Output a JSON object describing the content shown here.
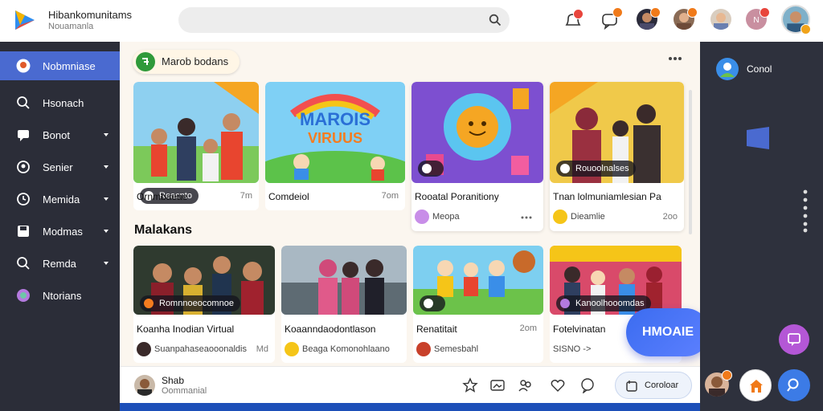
{
  "header": {
    "brand_title": "Hibankomunitams",
    "brand_subtitle": "Nouamanla",
    "search_placeholder": "",
    "icons": [
      "bell-icon",
      "chat-bubble-icon"
    ],
    "accent": "#f07a1a"
  },
  "sidebar": {
    "items": [
      {
        "label": "Nobmniase",
        "icon": "community-icon",
        "active": true,
        "chevron": false
      },
      {
        "label": "Hsonach",
        "icon": "search-icon",
        "active": false,
        "chevron": false
      },
      {
        "label": "Bonot",
        "icon": "chat-icon",
        "active": false,
        "chevron": true
      },
      {
        "label": "Senier",
        "icon": "group-icon",
        "active": false,
        "chevron": true
      },
      {
        "label": "Memida",
        "icon": "media-icon",
        "active": false,
        "chevron": true
      },
      {
        "label": "Modmas",
        "icon": "save-icon",
        "active": false,
        "chevron": true
      },
      {
        "label": "Remda",
        "icon": "search-alt-icon",
        "active": false,
        "chevron": true
      },
      {
        "label": "Ntorians",
        "icon": "globe-icon",
        "active": false,
        "chevron": false
      }
    ]
  },
  "main": {
    "chip_label": "Marob bodans",
    "section_title": "Malakans",
    "row1": [
      {
        "tag": "Reacnto",
        "title": "Ornmbaeae",
        "meta": "7m",
        "sub": "",
        "scene": "family"
      },
      {
        "tag": "",
        "title": "Comdeiol",
        "meta": "7om",
        "sub": "",
        "scene": "cartoon",
        "logo_line1": "MAROIS",
        "logo_line2": "VIRUUS"
      },
      {
        "tag": "",
        "title": "Rooatal Poranitiony",
        "meta": "",
        "sub": "Meopa",
        "scene": "sun"
      },
      {
        "tag": "Rouoolnalses",
        "title": "Tnan lolmuniamlesian Pa",
        "meta": "",
        "sub": "Dieamlie",
        "meta2": "2oo",
        "scene": "family2"
      }
    ],
    "row2": [
      {
        "tag": "Romnnoeocomnoe",
        "title": "Koanha Inodian Virtual",
        "sub": "Suanpahaseaooonaldis",
        "meta": "Md",
        "scene": "group"
      },
      {
        "tag": "",
        "title": "Koaanndaodontlason",
        "sub": "Beaga Komonohlaano",
        "meta": "",
        "scene": "beach"
      },
      {
        "tag": "",
        "title": "Renatitait",
        "sub": "Semesbahl",
        "meta": "2om",
        "scene": "kids"
      },
      {
        "tag": "Kanoolhooomdas",
        "title": "Fotelvinatan",
        "sub": "SISNO ->",
        "meta": "",
        "scene": "party"
      }
    ],
    "fab_label": "HMOAIE"
  },
  "right_panel": {
    "account_label": "Conol"
  },
  "bottom": {
    "user_name": "Shab",
    "user_role": "Oommanial",
    "action_label": "Coroloar"
  }
}
